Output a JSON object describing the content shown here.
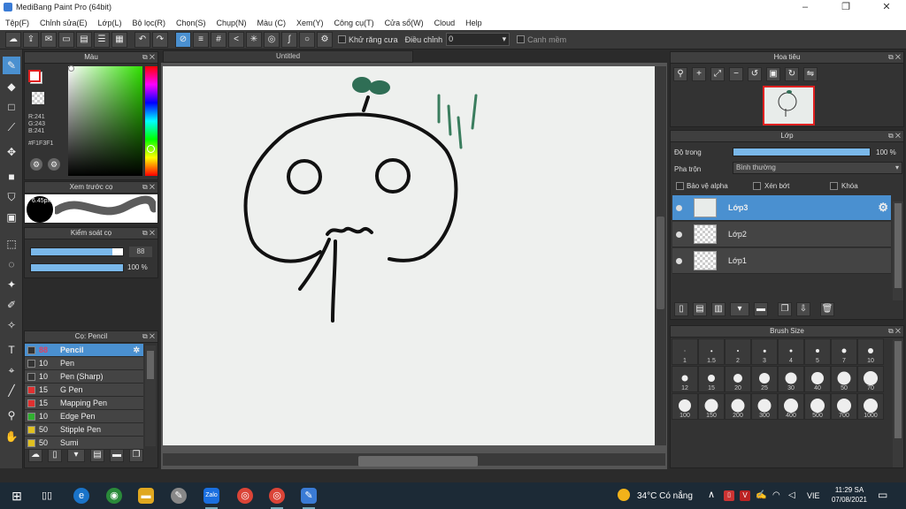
{
  "window": {
    "title": "MediBang Paint Pro (64bit)",
    "controls": [
      "–",
      "❐",
      "✕"
    ]
  },
  "menu": [
    "Tệp(F)",
    "Chỉnh sửa(E)",
    "Lớp(L)",
    "Bộ lọc(R)",
    "Chọn(S)",
    "Chụp(N)",
    "Màu (C)",
    "Xem(Y)",
    "Công cụ(T)",
    "Cửa sổ(W)",
    "Cloud",
    "Help"
  ],
  "toolbar": {
    "antialias_label": "Khử răng cưa",
    "adjust_label": "Điều chỉnh",
    "adjust_value": "0",
    "snap_label": "Canh mềm"
  },
  "canvas": {
    "tab_title": "Untitled"
  },
  "color_panel": {
    "title": "Màu",
    "r": "R:241",
    "g": "G:243",
    "b": "B:241",
    "hex": "#F1F3F1",
    "primary": "#ffffff",
    "secondary": "#e02020"
  },
  "preview_panel": {
    "title": "Xem trước cọ",
    "size_label": "6.45px"
  },
  "brush_control": {
    "title": "Kiểm soát cọ",
    "size_value": "88",
    "opacity_value": "100 %",
    "size_frac": 0.88,
    "opacity_frac": 1.0
  },
  "brush_list": {
    "title": "Cọ: Pencil",
    "items": [
      {
        "size": "88",
        "name": "Pencil",
        "color": "#333333",
        "selected": true
      },
      {
        "size": "10",
        "name": "Pen",
        "color": "#333333"
      },
      {
        "size": "10",
        "name": "Pen (Sharp)",
        "color": "#333333"
      },
      {
        "size": "15",
        "name": "G Pen",
        "color": "#e03030"
      },
      {
        "size": "15",
        "name": "Mapping Pen",
        "color": "#e03030"
      },
      {
        "size": "10",
        "name": "Edge Pen",
        "color": "#30b030"
      },
      {
        "size": "50",
        "name": "Stipple Pen",
        "color": "#e0c020"
      },
      {
        "size": "50",
        "name": "Sumi",
        "color": "#e0c020"
      }
    ]
  },
  "navigator": {
    "title": "Hoa tiêu"
  },
  "layers": {
    "title": "Lớp",
    "opacity_label": "Độ trong",
    "opacity_value": "100 %",
    "opacity_frac": 1.0,
    "blend_label": "Pha trộn",
    "blend_value": "Bình thường",
    "protect_alpha": "Bảo vệ alpha",
    "clipping": "Xén bớt",
    "lock": "Khóa",
    "items": [
      {
        "name": "Lớp3",
        "selected": true
      },
      {
        "name": "Lớp2"
      },
      {
        "name": "Lớp1"
      }
    ]
  },
  "brush_size": {
    "title": "Brush Size",
    "sizes": [
      "1",
      "1.5",
      "2",
      "3",
      "4",
      "5",
      "7",
      "10",
      "12",
      "15",
      "20",
      "25",
      "30",
      "40",
      "50",
      "70",
      "100",
      "150",
      "200",
      "300",
      "400",
      "500",
      "700",
      "1000"
    ]
  },
  "taskbar": {
    "weather": "34°C  Có nắng",
    "lang": "VIE",
    "time": "11:29 SA",
    "date": "07/08/2021"
  }
}
